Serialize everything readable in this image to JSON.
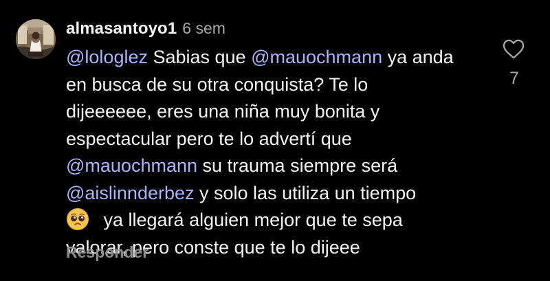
{
  "comment": {
    "username": "almasantoyo1",
    "timestamp": "6 sem",
    "lines": [
      [
        {
          "type": "mention",
          "text": "@lologlez"
        },
        {
          "type": "text",
          "text": " Sabias que "
        },
        {
          "type": "mention",
          "text": "@mauochmann"
        },
        {
          "type": "text",
          "text": " ya anda"
        }
      ],
      [
        {
          "type": "text",
          "text": "en busca de su otra conquista? Te lo"
        }
      ],
      [
        {
          "type": "text",
          "text": "dijeeeeee, eres una niña muy bonita y"
        }
      ],
      [
        {
          "type": "text",
          "text": "espectacular pero te lo advertí que"
        }
      ],
      [
        {
          "type": "mention",
          "text": "@mauochmann"
        },
        {
          "type": "text",
          "text": " su trauma siempre será"
        }
      ],
      [
        {
          "type": "mention",
          "text": "@aislinnderbez"
        },
        {
          "type": "text",
          "text": " y solo las utiliza un tiempo"
        }
      ],
      [
        {
          "type": "emoji",
          "name": "pleading-face-emoji"
        },
        {
          "type": "text",
          "text": " ya llegará alguien mejor que te sepa"
        }
      ],
      [
        {
          "type": "text",
          "text": "valorar, pero conste que te lo dijeee"
        }
      ]
    ],
    "reply_label": "Responder",
    "like_count": "7"
  },
  "icons": {
    "like": "heart-outline-icon",
    "emoji": "pleading-face-emoji"
  },
  "colors": {
    "background": "#000000",
    "text": "#f5f5f5",
    "mention": "#a9b4ff",
    "secondary": "#a8a8a8",
    "reply": "#8e8e8e"
  }
}
